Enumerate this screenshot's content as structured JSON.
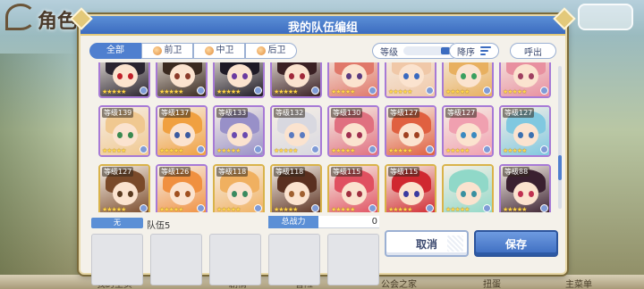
{
  "background": {
    "title": "角色",
    "nav_items": [
      "我的主页",
      "剧情",
      "冒险",
      "公会之家",
      "扭蛋",
      "主菜单"
    ]
  },
  "dialog": {
    "title": "我的队伍编组",
    "filter_tabs": [
      {
        "label": "全部",
        "active": true
      },
      {
        "label": "前卫",
        "active": false
      },
      {
        "label": "中卫",
        "active": false
      },
      {
        "label": "后卫",
        "active": false
      }
    ],
    "sort_field_label": "等级",
    "sort_order_label": "降序",
    "call_out_label": "呼出"
  },
  "characters": [
    {
      "level": "",
      "stars": 5,
      "frame": "purple",
      "hair": "#2a2430",
      "eyes": "#c0202a"
    },
    {
      "level": "",
      "stars": 5,
      "frame": "purple",
      "hair": "#3a2a20",
      "eyes": "#8a3a2a"
    },
    {
      "level": "",
      "stars": 5,
      "frame": "purple",
      "hair": "#1e1a26",
      "eyes": "#6a3aa0"
    },
    {
      "level": "",
      "stars": 5,
      "frame": "purple",
      "hair": "#3a2024",
      "eyes": "#a0283a"
    },
    {
      "level": "",
      "stars": 5,
      "frame": "purple",
      "hair": "#e0786a",
      "eyes": "#5a3a80"
    },
    {
      "level": "",
      "stars": 5,
      "frame": "purple",
      "hair": "#f0c8a8",
      "eyes": "#3a6ac0"
    },
    {
      "level": "",
      "stars": 5,
      "frame": "purple",
      "hair": "#e8b060",
      "eyes": "#3aa060"
    },
    {
      "level": "",
      "stars": 5,
      "frame": "purple",
      "hair": "#e890a0",
      "eyes": "#a04060"
    },
    {
      "level": "等级139",
      "stars": 5,
      "frame": "purple",
      "hair": "#f0c890",
      "eyes": "#3a8a50"
    },
    {
      "level": "等级137",
      "stars": 5,
      "frame": "purple",
      "hair": "#f0a040",
      "eyes": "#3a5aa0"
    },
    {
      "level": "等级133",
      "stars": 5,
      "frame": "purple",
      "hair": "#9890c8",
      "eyes": "#6a4ab0"
    },
    {
      "level": "等级132",
      "stars": 5,
      "frame": "purple",
      "hair": "#d8d8e0",
      "eyes": "#5a7ac0"
    },
    {
      "level": "等级130",
      "stars": 5,
      "frame": "purple",
      "hair": "#e07080",
      "eyes": "#a03050"
    },
    {
      "level": "等级127",
      "stars": 5,
      "frame": "purple",
      "hair": "#e06040",
      "eyes": "#a04020"
    },
    {
      "level": "等级127",
      "stars": 5,
      "frame": "purple",
      "hair": "#f0a0b0",
      "eyes": "#3a8ac0"
    },
    {
      "level": "等级127",
      "stars": 5,
      "frame": "purple",
      "hair": "#80c8e0",
      "eyes": "#3a70b0"
    },
    {
      "level": "等级127",
      "stars": 5,
      "frame": "gold",
      "hair": "#7a4a2a",
      "eyes": "#5a3a20"
    },
    {
      "level": "等级126",
      "stars": 5,
      "frame": "purple",
      "hair": "#f09040",
      "eyes": "#a05020"
    },
    {
      "level": "等级118",
      "stars": 5,
      "frame": "gold",
      "hair": "#f0b060",
      "eyes": "#3a8a60"
    },
    {
      "level": "等级118",
      "stars": 5,
      "frame": "gold",
      "hair": "#5a3020",
      "eyes": "#a06030"
    },
    {
      "level": "等级115",
      "stars": 5,
      "frame": "gold",
      "hair": "#e05060",
      "eyes": "#a03040"
    },
    {
      "level": "等级115",
      "stars": 5,
      "frame": "gold",
      "hair": "#d02830",
      "eyes": "#3a3aa0"
    },
    {
      "level": "",
      "stars": 5,
      "frame": "gold",
      "hair": "#90d8c8",
      "eyes": "#3a90a0"
    },
    {
      "level": "等级88",
      "stars": 5,
      "frame": "purple",
      "hair": "#3a2030",
      "eyes": "#c03050"
    }
  ],
  "team": {
    "left_label": "无",
    "team_name": "队伍5",
    "power_label": "总战力",
    "power_value": "0",
    "slots": 5
  },
  "buttons": {
    "cancel_label": "取消",
    "save_label": "保存"
  }
}
